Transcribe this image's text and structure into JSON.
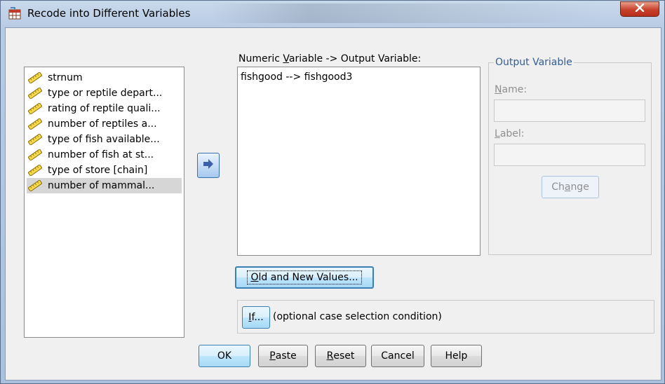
{
  "window": {
    "title": "Recode into Different Variables"
  },
  "variables": {
    "items": [
      {
        "label": "strnum",
        "selected": false
      },
      {
        "label": "type or reptile depart...",
        "selected": false
      },
      {
        "label": "rating of reptile quali...",
        "selected": false
      },
      {
        "label": "number of reptiles a...",
        "selected": false
      },
      {
        "label": "type of fish available...",
        "selected": false
      },
      {
        "label": "number of fish at st...",
        "selected": false
      },
      {
        "label": "type of store [chain]",
        "selected": false
      },
      {
        "label": "number of mammal...",
        "selected": true
      }
    ]
  },
  "numeric_variable": {
    "label_pre": "Numeric ",
    "label_mnemonic": "V",
    "label_post": "ariable -> Output Variable:",
    "items": [
      "fishgood --> fishgood3"
    ]
  },
  "output_variable": {
    "legend": "Output Variable",
    "name_mnemonic": "N",
    "name_rest": "ame:",
    "name_value": "",
    "label_mnemonic": "L",
    "label_rest": "abel:",
    "label_value": "",
    "change_pre": "Ch",
    "change_mnemonic": "a",
    "change_post": "nge"
  },
  "old_new_button": {
    "mnemonic": "O",
    "rest": "ld and New Values..."
  },
  "if_section": {
    "button_mnemonic": "I",
    "button_rest": "f...",
    "description": "(optional case selection condition)"
  },
  "footer_buttons": {
    "ok": "OK",
    "paste_mnemonic": "P",
    "paste_rest": "aste",
    "reset_mnemonic": "R",
    "reset_rest": "eset",
    "cancel": "Cancel",
    "help": "Help"
  },
  "colors": {
    "accent": "#3c7fb1",
    "close_button": "#c7402a",
    "legend_text": "#335c94",
    "disabled_text": "#8f8f8f"
  },
  "icons": {
    "app": "recode-icon",
    "close": "close-x-icon",
    "move": "right-arrow-icon",
    "variable": "scale-ruler-icon"
  }
}
